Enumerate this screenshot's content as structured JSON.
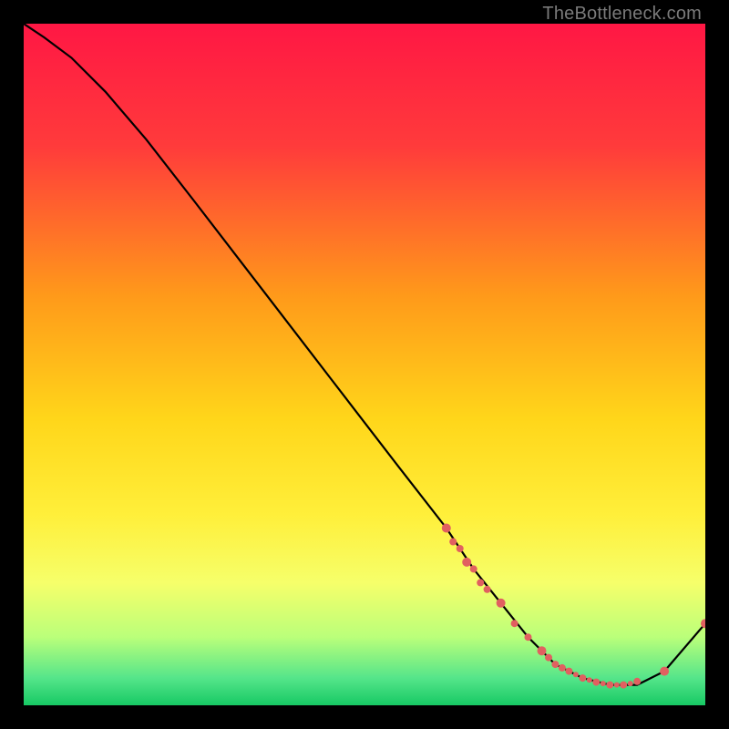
{
  "watermark": "TheBottleneck.com",
  "colors": {
    "gradient_stops": [
      {
        "offset": 0.0,
        "color": "#ff1744"
      },
      {
        "offset": 0.18,
        "color": "#ff3b3b"
      },
      {
        "offset": 0.4,
        "color": "#ff9a1a"
      },
      {
        "offset": 0.58,
        "color": "#ffd61a"
      },
      {
        "offset": 0.72,
        "color": "#ffef3a"
      },
      {
        "offset": 0.82,
        "color": "#f6ff6a"
      },
      {
        "offset": 0.9,
        "color": "#baff7a"
      },
      {
        "offset": 0.96,
        "color": "#55e58a"
      },
      {
        "offset": 1.0,
        "color": "#17c964"
      }
    ],
    "curve": "#000000",
    "marker": "#e16060"
  },
  "chart_data": {
    "type": "line",
    "title": "",
    "xlabel": "",
    "ylabel": "",
    "xlim": [
      0,
      100
    ],
    "ylim": [
      0,
      100
    ],
    "series": [
      {
        "name": "curve",
        "x": [
          0,
          3,
          7,
          12,
          18,
          25,
          35,
          45,
          55,
          62,
          66,
          70,
          74,
          78,
          82,
          86,
          90,
          94,
          100
        ],
        "y": [
          100,
          98,
          95,
          90,
          83,
          74,
          61,
          48,
          35,
          26,
          20,
          15,
          10,
          6,
          4,
          3,
          3,
          5,
          12
        ]
      }
    ],
    "markers": {
      "name": "highlight-points",
      "x": [
        62,
        63,
        64,
        65,
        66,
        67,
        68,
        70,
        72,
        74,
        76,
        77,
        78,
        79,
        80,
        81,
        82,
        83,
        84,
        85,
        86,
        87,
        88,
        89,
        90,
        94,
        100
      ],
      "y": [
        26,
        24,
        23,
        21,
        20,
        18,
        17,
        15,
        12,
        10,
        8,
        7,
        6,
        5.5,
        5,
        4.5,
        4,
        3.7,
        3.4,
        3.2,
        3,
        3,
        3,
        3.2,
        3.5,
        5,
        12
      ],
      "r": [
        5,
        4,
        4,
        5,
        4,
        4,
        4,
        5,
        4,
        4,
        5,
        4,
        4,
        4,
        4,
        3,
        4,
        3,
        4,
        3,
        4,
        3,
        4,
        3,
        4,
        5,
        5
      ]
    }
  }
}
